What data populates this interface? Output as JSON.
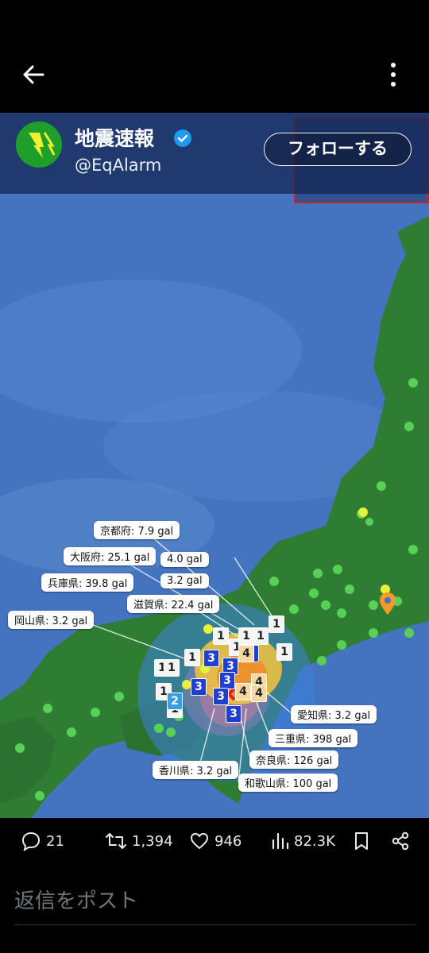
{
  "account": {
    "display_name": "地震速報",
    "handle": "@EqAlarm",
    "follow_label": "フォローする",
    "verified": true
  },
  "map": {
    "labels": [
      {
        "text": "京都府: 7.9 gal"
      },
      {
        "text": "大阪府: 25.1 gal"
      },
      {
        "text": "4.0 gal"
      },
      {
        "text": "兵庫県: 39.8 gal"
      },
      {
        "text": "3.2 gal"
      },
      {
        "text": "滋賀県: 22.4 gal"
      },
      {
        "text": "岡山県: 3.2 gal"
      },
      {
        "text": "愛知県: 3.2 gal"
      },
      {
        "text": "三重県: 398 gal"
      },
      {
        "text": "奈良県: 126 gal"
      },
      {
        "text": "香川県: 3.2 gal"
      },
      {
        "text": "和歌山県: 100 gal"
      }
    ],
    "intensity_markers": [
      "1",
      "1",
      "1",
      "1",
      "1",
      "1",
      "1",
      "1",
      "1",
      "1",
      "1",
      "3",
      "3",
      "3",
      "3",
      "3",
      "3",
      "3",
      "2",
      "4",
      "4",
      "4",
      "4"
    ],
    "colors": {
      "sea": "#3f6fb8",
      "land": "#2e7d32",
      "marker_1": "#f4f4f4",
      "marker_2": "#3a9fe0",
      "marker_3": "#1f3fd1",
      "marker_4": "#f6d8a3",
      "epicenter": "#e02020"
    }
  },
  "actions": {
    "replies": "21",
    "reposts": "1,394",
    "likes": "946",
    "views": "82.3K"
  },
  "reply": {
    "placeholder": "返信をポスト"
  }
}
